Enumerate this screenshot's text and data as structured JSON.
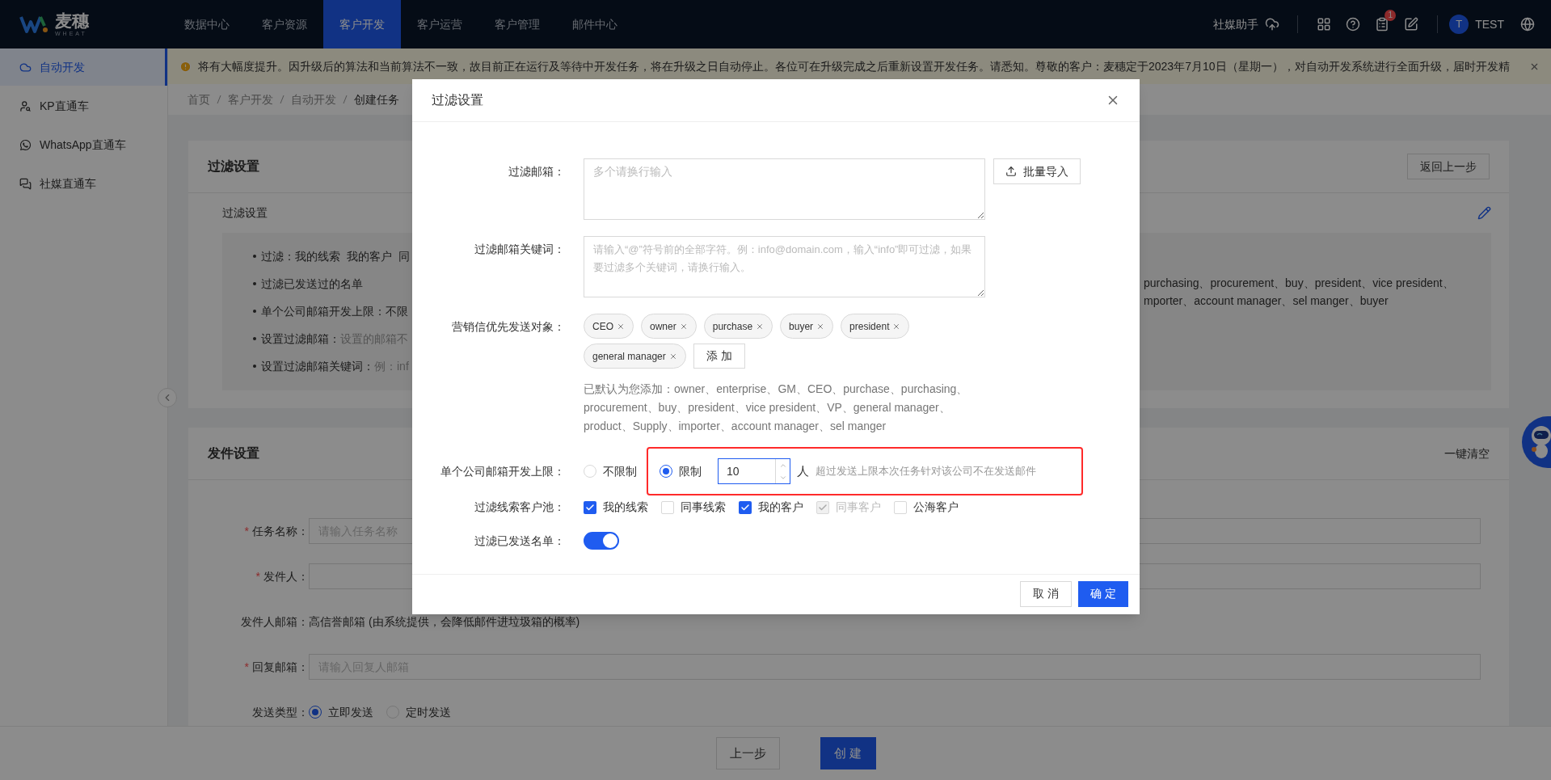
{
  "top_nav": {
    "logo": {
      "name": "麦穗",
      "subtitle": "WHEAT"
    },
    "items": [
      {
        "label": "数据中心",
        "selected": false
      },
      {
        "label": "客户资源",
        "selected": false
      },
      {
        "label": "客户开发",
        "selected": true
      },
      {
        "label": "客户运营",
        "selected": false
      },
      {
        "label": "客户管理",
        "selected": false
      },
      {
        "label": "邮件中心",
        "selected": false
      }
    ],
    "social_helper": "社媒助手",
    "notification_badge": "1",
    "user": {
      "avatar": "T",
      "name": "TEST"
    }
  },
  "sidebar": {
    "items": [
      {
        "label": "自动开发",
        "selected": true
      },
      {
        "label": "KP直通车",
        "selected": false
      },
      {
        "label": "WhatsApp直通车",
        "selected": false
      },
      {
        "label": "社媒直通车",
        "selected": false
      }
    ]
  },
  "alert": {
    "text": "将有大幅度提升。因升级后的算法和当前算法不一致，故目前正在运行及等待中开发任务，将在升级之日自动停止。各位可在升级完成之后重新设置开发任务。请悉知。尊敬的客户：麦穗定于2023年7月10日（星期一），对自动开发系统进行全面升级，届时开发精"
  },
  "breadcrumb": [
    "首页",
    "客户开发",
    "自动开发",
    "创建任务"
  ],
  "filter_card": {
    "title": "过滤设置",
    "back_button": "返回上一步",
    "section_label": "过滤设置",
    "summary": [
      {
        "label": "过滤：",
        "value": "我的线索  我的客户  同",
        "value_muted": false
      },
      {
        "label": "过滤已发送过的名单"
      },
      {
        "label": "单个公司邮箱开发上限：",
        "value": "不限",
        "value_muted": false
      },
      {
        "label": "设置过滤邮箱：",
        "value": "设置的邮箱不",
        "value_muted": true
      },
      {
        "label": "设置过滤邮箱关键词：",
        "value": "例：inf",
        "value_muted": true
      }
    ],
    "summary_overflow": [
      "purchasing、procurement、buy、president、vice president、",
      "mporter、account manager、sel manger、buyer"
    ]
  },
  "send_card": {
    "title": "发件设置",
    "clear_link": "一键清空",
    "fields": [
      {
        "kind": "input",
        "required_mark": "*",
        "label": "任务名称：",
        "placeholder": "请输入任务名称"
      },
      {
        "kind": "input",
        "required_mark": "*",
        "label": "发件人："
      },
      {
        "kind": "text",
        "label": "发件人邮箱：",
        "value": "高信誉邮箱 (由系统提供，会降低邮件进垃圾箱的概率)"
      },
      {
        "kind": "input",
        "required_mark": "*",
        "label": "回复邮箱：",
        "placeholder": "请输入回复人邮箱"
      },
      {
        "kind": "radio",
        "label": "发送类型：",
        "options": [
          {
            "label": "立即发送",
            "selected": true
          },
          {
            "label": "定时发送",
            "selected": false
          }
        ]
      }
    ]
  },
  "bottom_bar": {
    "buttons": [
      {
        "kind": "default",
        "label": "上一步"
      },
      {
        "kind": "primary",
        "label": "创 建"
      }
    ]
  },
  "modal": {
    "title": "过滤设置",
    "filter_emails": {
      "label": "过滤邮箱：",
      "placeholder": "多个请换行输入",
      "import_button": "批量导入"
    },
    "keywords": {
      "label": "过滤邮箱关键词：",
      "placeholder": "请输入“@”符号前的全部字符。例：info@domain.com，输入“info”即可过滤，如果要过滤多个关键词，请换行输入。"
    },
    "priority_targets": {
      "label": "营销信优先发送对象：",
      "tags": [
        "CEO",
        "owner",
        "purchase",
        "buyer",
        "president",
        "general manager"
      ],
      "add_button": "添 加",
      "hint": "已默认为您添加：owner、enterprise、GM、CEO、purchase、purchasing、procurement、buy、president、vice president、VP、general manager、product、Supply、importer、account manager、sel manger"
    },
    "limit": {
      "label": "单个公司邮箱开发上限：",
      "highlighted": true,
      "options": [
        {
          "label": "不限制",
          "selected": false
        },
        {
          "label": "限制",
          "selected": true
        }
      ],
      "value": "10",
      "unit": "人",
      "note": "超过发送上限本次任务针对该公司不在发送邮件"
    },
    "pools": {
      "label": "过滤线索客户池：",
      "options": [
        {
          "label": "我的线索",
          "checked": true,
          "disabled": false
        },
        {
          "label": "同事线索",
          "checked": false,
          "disabled": false
        },
        {
          "label": "我的客户",
          "checked": true,
          "disabled": false
        },
        {
          "label": "同事客户",
          "checked": true,
          "disabled": true
        },
        {
          "label": "公海客户",
          "checked": false,
          "disabled": false
        }
      ]
    },
    "filter_sent": {
      "label": "过滤已发送名单：",
      "on": true
    },
    "footer": {
      "cancel": "取 消",
      "confirm": "确 定"
    }
  }
}
